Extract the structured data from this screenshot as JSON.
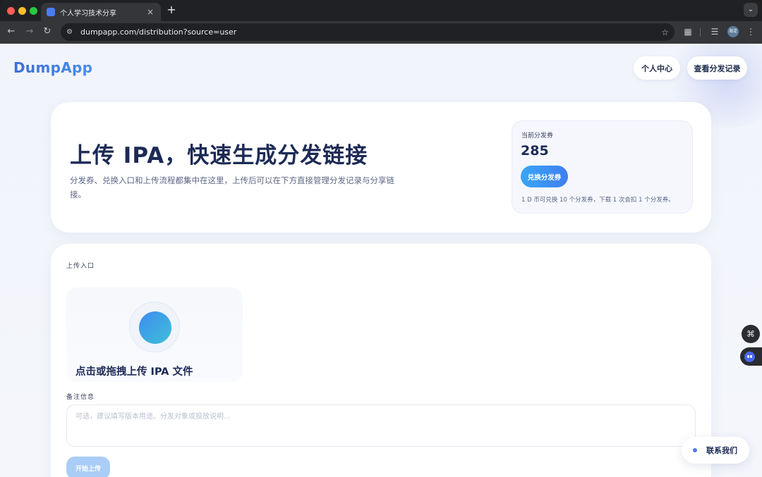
{
  "browser": {
    "tab_title": "个人学习技术分享",
    "tab_close_icon": "×",
    "new_tab_icon": "+",
    "url": "dumpapp.com/distribution?source=user",
    "profile_badge": "海淀"
  },
  "header": {
    "logo": "DumpApp",
    "nav": {
      "personal_center": "个人中心",
      "view_records": "查看分发记录"
    }
  },
  "hero": {
    "title": "上传 IPA，快速生成分发链接",
    "description": "分发券、兑换入口和上传流程都集中在这里，上传后可以在下方直接管理分发记录与分享链接。",
    "coupon": {
      "label": "当前分发券",
      "value": "285",
      "redeem_button": "兑换分发券",
      "note": "1 D 币可兑换 10 个分发券，下载 1 次会扣 1 个分发券。"
    }
  },
  "upload": {
    "section_label": "上传入口",
    "dropzone_text": "点击或拖拽上传 IPA 文件",
    "note_label": "备注信息",
    "note_placeholder": "可选，建议填写版本用途、分发对象或投放说明...",
    "start_button": "开始上传"
  },
  "floating": {
    "contact_label": "联系我们"
  },
  "colors": {
    "accent": "#3f7ef0",
    "title": "#1c2a55",
    "page_bg": "#f1f4fb"
  }
}
